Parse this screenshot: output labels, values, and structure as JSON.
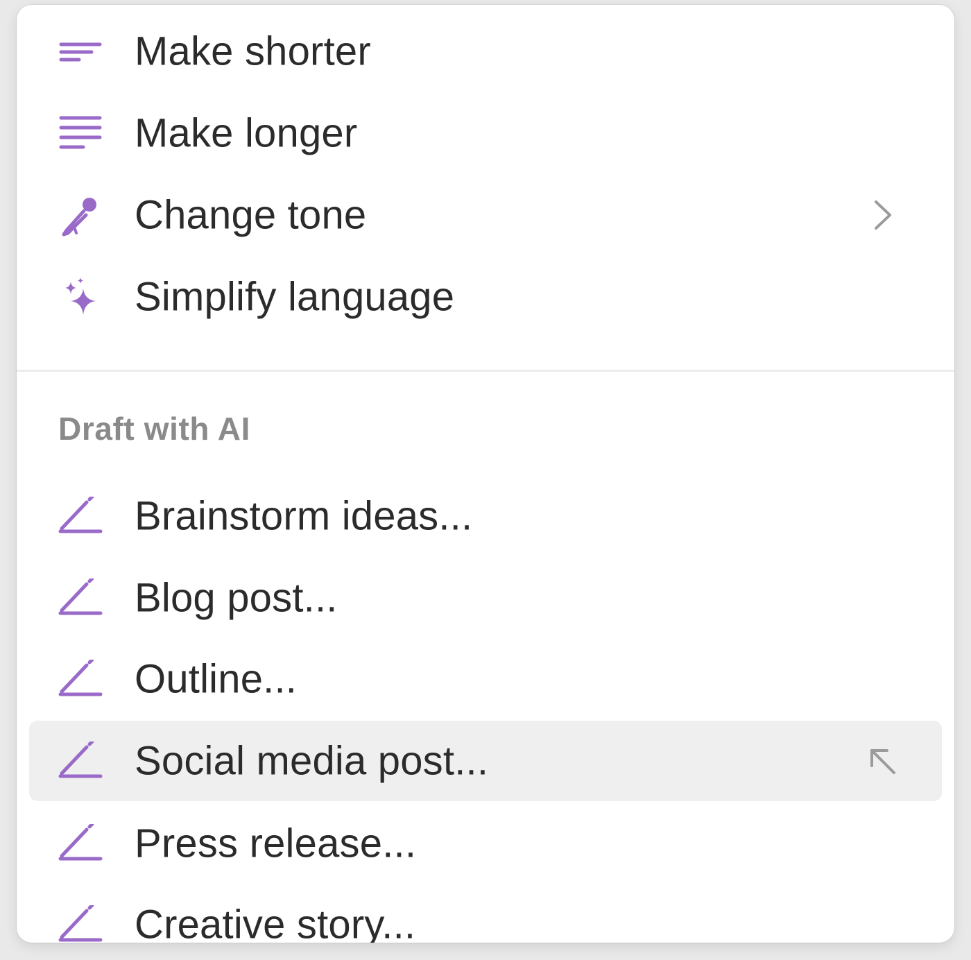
{
  "colors": {
    "accent": "#9a6ac8",
    "text": "#2b2b2b",
    "muted": "#8a8a8a",
    "highlight": "#efefef"
  },
  "edit_items": [
    {
      "label": "Make shorter",
      "icon": "short-lines-icon"
    },
    {
      "label": "Make longer",
      "icon": "long-lines-icon"
    },
    {
      "label": "Change tone",
      "icon": "microphone-icon",
      "trailing": "chevron-right-icon"
    },
    {
      "label": "Simplify language",
      "icon": "sparkles-icon"
    }
  ],
  "draft_section": {
    "title": "Draft with AI",
    "items": [
      {
        "label": "Brainstorm ideas...",
        "icon": "pencil-line-icon"
      },
      {
        "label": "Blog post...",
        "icon": "pencil-line-icon"
      },
      {
        "label": "Outline...",
        "icon": "pencil-line-icon"
      },
      {
        "label": "Social media post...",
        "icon": "pencil-line-icon",
        "highlighted": true,
        "trailing": "arrow-up-left-icon"
      },
      {
        "label": "Press release...",
        "icon": "pencil-line-icon"
      },
      {
        "label": "Creative story...",
        "icon": "pencil-line-icon"
      }
    ]
  }
}
